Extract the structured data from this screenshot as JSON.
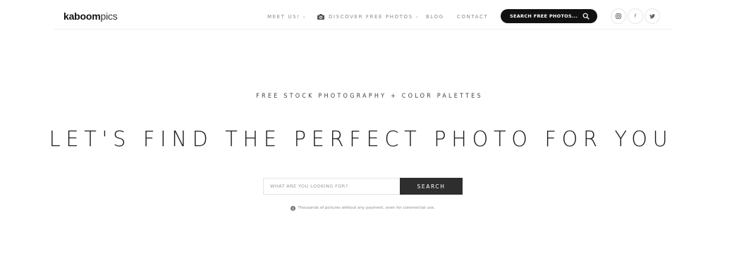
{
  "logo": {
    "bold": "kaboom",
    "light": "pics"
  },
  "nav": {
    "meet_us": "MEET US!",
    "discover": "DISCOVER FREE PHOTOS",
    "blog": "BLOG",
    "contact": "CONTACT",
    "chevron": "⌄"
  },
  "header_search": {
    "label": "SEARCH FREE PHOTOS..."
  },
  "social": {
    "instagram_icon": "instagram-icon",
    "facebook": "f",
    "twitter_icon": "twitter-icon"
  },
  "hero": {
    "tagline": "FREE STOCK PHOTOGRAPHY + COLOR PALETTES",
    "headline": "LET'S FIND THE PERFECT PHOTO FOR YOU",
    "search_placeholder": "WHAT ARE YOU LOOKING FOR?",
    "search_button": "SEARCH",
    "note": "Thousands of pictures without any payment, even for commercial use."
  },
  "colors": {
    "accent_dark": "#111111",
    "button_dark": "#2e2e2e",
    "muted_text": "#8a8a8a"
  }
}
